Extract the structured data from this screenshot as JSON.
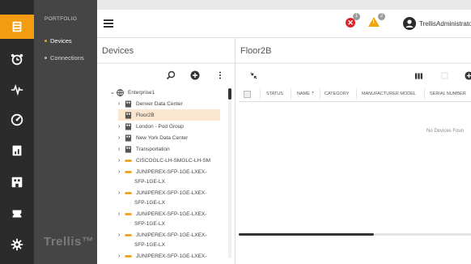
{
  "app": {
    "brand": "Trellis™",
    "user_name": "TrellisAdministrato"
  },
  "nav": {
    "title": "PORTFOLIO",
    "items": [
      {
        "label": "Devices"
      },
      {
        "label": "Connections"
      }
    ]
  },
  "alerts": {
    "error_count": "1",
    "warning_count": "2"
  },
  "devices_panel": {
    "title": "Devices",
    "tree": [
      {
        "label": "Enterprise1",
        "level": 0,
        "icon": "globe-icon"
      },
      {
        "label": "Denver Data Center",
        "level": 1,
        "icon": "building-icon"
      },
      {
        "label": "Floor2B",
        "level": 1,
        "icon": "building-icon",
        "selected": true
      },
      {
        "label": "London - Pod Group",
        "level": 1,
        "icon": "building-icon"
      },
      {
        "label": "New York Data Center",
        "level": 1,
        "icon": "building-icon"
      },
      {
        "label": "Transportation",
        "level": 1,
        "icon": "building-icon"
      },
      {
        "label": "CISCOGLC-LH-SMGLC-LH-SM",
        "level": 1,
        "icon": "device-icon"
      },
      {
        "label": "JUNIPEREX-SFP-1GE-LXEX-",
        "level": 1,
        "icon": "device-icon"
      },
      {
        "label": "SFP-1GE-LX",
        "level": 1,
        "icon": "none"
      },
      {
        "label": "JUNIPEREX-SFP-1GE-LXEX-",
        "level": 1,
        "icon": "device-icon"
      },
      {
        "label": "SFP-1GE-LX",
        "level": 1,
        "icon": "none"
      },
      {
        "label": "JUNIPEREX-SFP-1GE-LXEX-",
        "level": 1,
        "icon": "device-icon"
      },
      {
        "label": "SFP-1GE-LX",
        "level": 1,
        "icon": "none"
      },
      {
        "label": "JUNIPEREX-SFP-1GE-LXEX-",
        "level": 1,
        "icon": "device-icon"
      },
      {
        "label": "SFP-1GE-LX",
        "level": 1,
        "icon": "none"
      },
      {
        "label": "JUNIPEREX-SFP-1GE-LXEX-",
        "level": 1,
        "icon": "device-icon"
      }
    ]
  },
  "floor_panel": {
    "title": "Floor2B",
    "columns": [
      "STATUS",
      "NAME ⇡",
      "CATEGORY",
      "MANUFACTURER MODEL",
      "SERIAL NUMBER"
    ],
    "empty_text": "No Devices Foun"
  }
}
